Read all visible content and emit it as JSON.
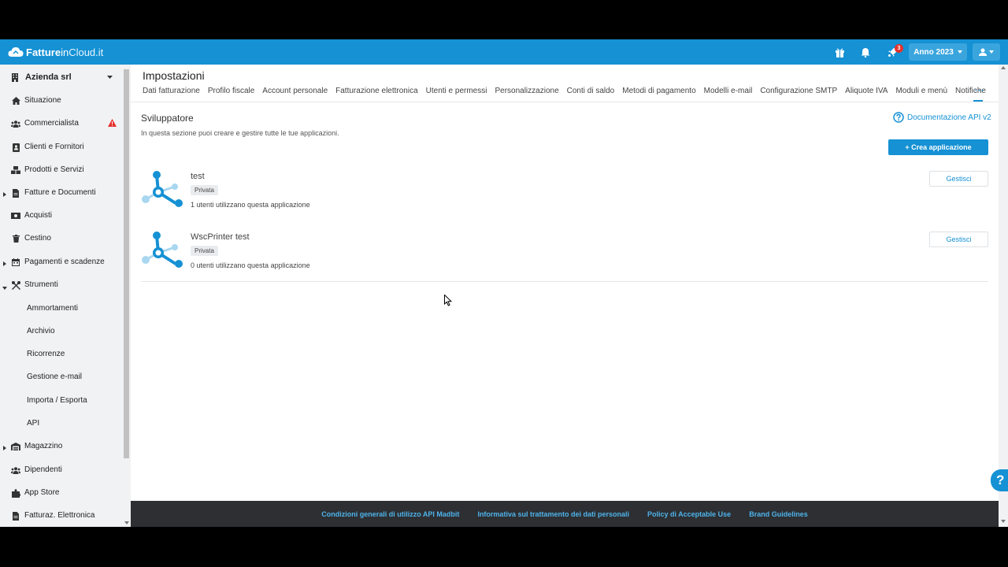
{
  "brand": {
    "name_bold": "Fatture",
    "name_mid": "in",
    "name_end": "Cloud.it"
  },
  "topbar": {
    "notifications_badge": "3",
    "year_label": "Anno 2023"
  },
  "sidebar": {
    "company": "Azienda srl",
    "items": [
      {
        "label": "Situazione",
        "icon": "home-icon"
      },
      {
        "label": "Commercialista",
        "icon": "users-icon",
        "warning": true
      },
      {
        "label": "Clienti e Fornitori",
        "icon": "address-book-icon"
      },
      {
        "label": "Prodotti e Servizi",
        "icon": "boxes-icon"
      },
      {
        "label": "Fatture e Documenti",
        "icon": "document-icon",
        "expandable": true
      },
      {
        "label": "Acquisti",
        "icon": "money-icon"
      },
      {
        "label": "Cestino",
        "icon": "trash-icon"
      },
      {
        "label": "Pagamenti e scadenze",
        "icon": "calendar-icon",
        "expandable": true
      },
      {
        "label": "Strumenti",
        "icon": "tools-icon",
        "expanded": true
      },
      {
        "label": "Ammortamenti"
      },
      {
        "label": "Archivio"
      },
      {
        "label": "Ricorrenze"
      },
      {
        "label": "Gestione e-mail"
      },
      {
        "label": "Importa / Esporta"
      },
      {
        "label": "API"
      },
      {
        "label": "Magazzino",
        "icon": "warehouse-icon",
        "expandable": true
      },
      {
        "label": "Dipendenti",
        "icon": "users-icon"
      },
      {
        "label": "App Store",
        "icon": "puzzle-icon"
      },
      {
        "label": "Fatturaz. Elettronica",
        "icon": "document-icon"
      }
    ]
  },
  "main": {
    "page_title": "Impostazioni",
    "tabs": [
      "Dati fatturazione",
      "Profilo fiscale",
      "Account personale",
      "Fatturazione elettronica",
      "Utenti e permessi",
      "Personalizzazione",
      "Conti di saldo",
      "Metodi di pagamento",
      "Modelli e-mail",
      "Configurazione SMTP",
      "Aliquote IVA",
      "Moduli e menù",
      "Notifiche"
    ],
    "tab_more": "···",
    "section_title": "Sviluppatore",
    "section_desc": "In questa sezione puoi creare e gestire tutte le tue applicazioni.",
    "doc_link": "Documentazione API v2",
    "create_button": "+ Crea applicazione",
    "apps": [
      {
        "name": "test",
        "visibility": "Privata",
        "users": "1 utenti utilizzano questa applicazione",
        "manage": "Gestisci"
      },
      {
        "name": "WscPrinter test",
        "visibility": "Privata",
        "users": "0 utenti utilizzano questa applicazione",
        "manage": "Gestisci"
      }
    ]
  },
  "footer": {
    "links": [
      "Condizioni generali di utilizzo API Madbit",
      "Informativa sul trattamento dei dati personali",
      "Policy di Acceptable Use",
      "Brand Guidelines"
    ]
  },
  "help_label": "?",
  "colors": {
    "primary": "#1591d4",
    "footer_bg": "#2d2f33",
    "sidebar_bg": "#f1f2f3",
    "warning": "#e5322d"
  }
}
